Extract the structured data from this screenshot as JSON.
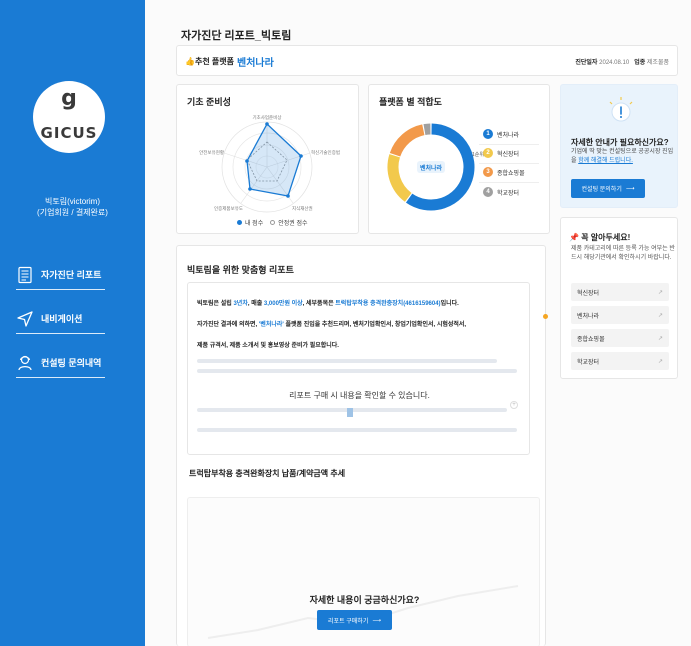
{
  "sidebar": {
    "logo_mark": "g",
    "logo_text": "GICUS",
    "user_name": "빅토림(victorim)",
    "user_sub": "(기업회원 / 결제완료)",
    "nav": [
      {
        "label": "자가진단 리포트",
        "icon": "report-icon"
      },
      {
        "label": "내비게이션",
        "icon": "navigation-icon"
      },
      {
        "label": "컨설팅 문의내역",
        "icon": "consultant-icon"
      }
    ]
  },
  "page_title": "자가진단 리포트_빅토림",
  "recommend": {
    "label": "👍추천 플랫폼",
    "value": "벤처나라",
    "date_label": "진단일자",
    "date_value": "2024.08.10",
    "industry_label": "업종",
    "industry_value": "제조물품"
  },
  "radar": {
    "title": "기초 준비성",
    "axes": [
      "기초사업준비상",
      "혁신기술인증범",
      "지식재산권",
      "인증제품보유도",
      "안전보유현황"
    ],
    "legend_mine": "내 점수",
    "legend_avg": "안정권 점수"
  },
  "platforms": {
    "title": "플랫폼 별 적합도",
    "center_label": "벤처나라",
    "first_label": "1순위",
    "items": [
      {
        "num": "1",
        "label": "벤처나라",
        "color": "#1a7bd4"
      },
      {
        "num": "2",
        "label": "혁신장터",
        "color": "#f2c94c"
      },
      {
        "num": "3",
        "label": "종합쇼핑몰",
        "color": "#f2994a"
      },
      {
        "num": "4",
        "label": "학교장터",
        "color": "#a0a0a0"
      }
    ]
  },
  "chart_data": {
    "type": "pie",
    "categories": [
      "벤처나라",
      "혁신장터",
      "종합쇼핑몰",
      "학교장터"
    ],
    "values": [
      60,
      20,
      17,
      3
    ],
    "colors": [
      "#1a7bd4",
      "#f2c94c",
      "#f2994a",
      "#a0a0a0"
    ]
  },
  "help": {
    "title": "자세한 안내가 필요하신가요?",
    "text_1": "기업에 딱 맞는 컨설팅으로 공공시장 진입을",
    "text_link": "함께 해결해 드립니다.",
    "button": "컨설팅 문의하기"
  },
  "notice": {
    "title": "📌 꼭 알아두세요!",
    "text": "제품 카테고리에 따른 등록 가능 여부는 반드시 해당기관에서 확인하시기 바랍니다.",
    "links": [
      "혁신장터",
      "벤처나라",
      "종합쇼핑몰",
      "학교장터"
    ]
  },
  "report": {
    "title": "빅토림을 위한 맞춤형 리포트",
    "line1_a": "빅토림은 설립 ",
    "line1_b": "3년차",
    "line1_c": ", 매출 ",
    "line1_d": "3,000만원 이상",
    "line1_e": ", 세부품목은 ",
    "line1_f": "트럭탑부착용 충격완충장치(4616159604)",
    "line1_g": "입니다.",
    "line2_a": "자가진단 결과에 의하면, ",
    "line2_b": "'벤처나라'",
    "line2_c": " 플랫폼 진입을 추천드리며, 벤처기업확인서, 창업기업확인서, 시험성적서,",
    "line3": "제품 규격서, 제품 소개서 및 홍보영상 준비가 필요합니다.",
    "locked": "리포트 구매 시 내용을 확인할 수 있습니다.",
    "trend_title": "트럭탑부착용 충격완화장치 납품/계약금액 추세",
    "cta_title": "자세한 내용이 궁금하신가요?",
    "cta_button": "리포트 구매하기"
  }
}
